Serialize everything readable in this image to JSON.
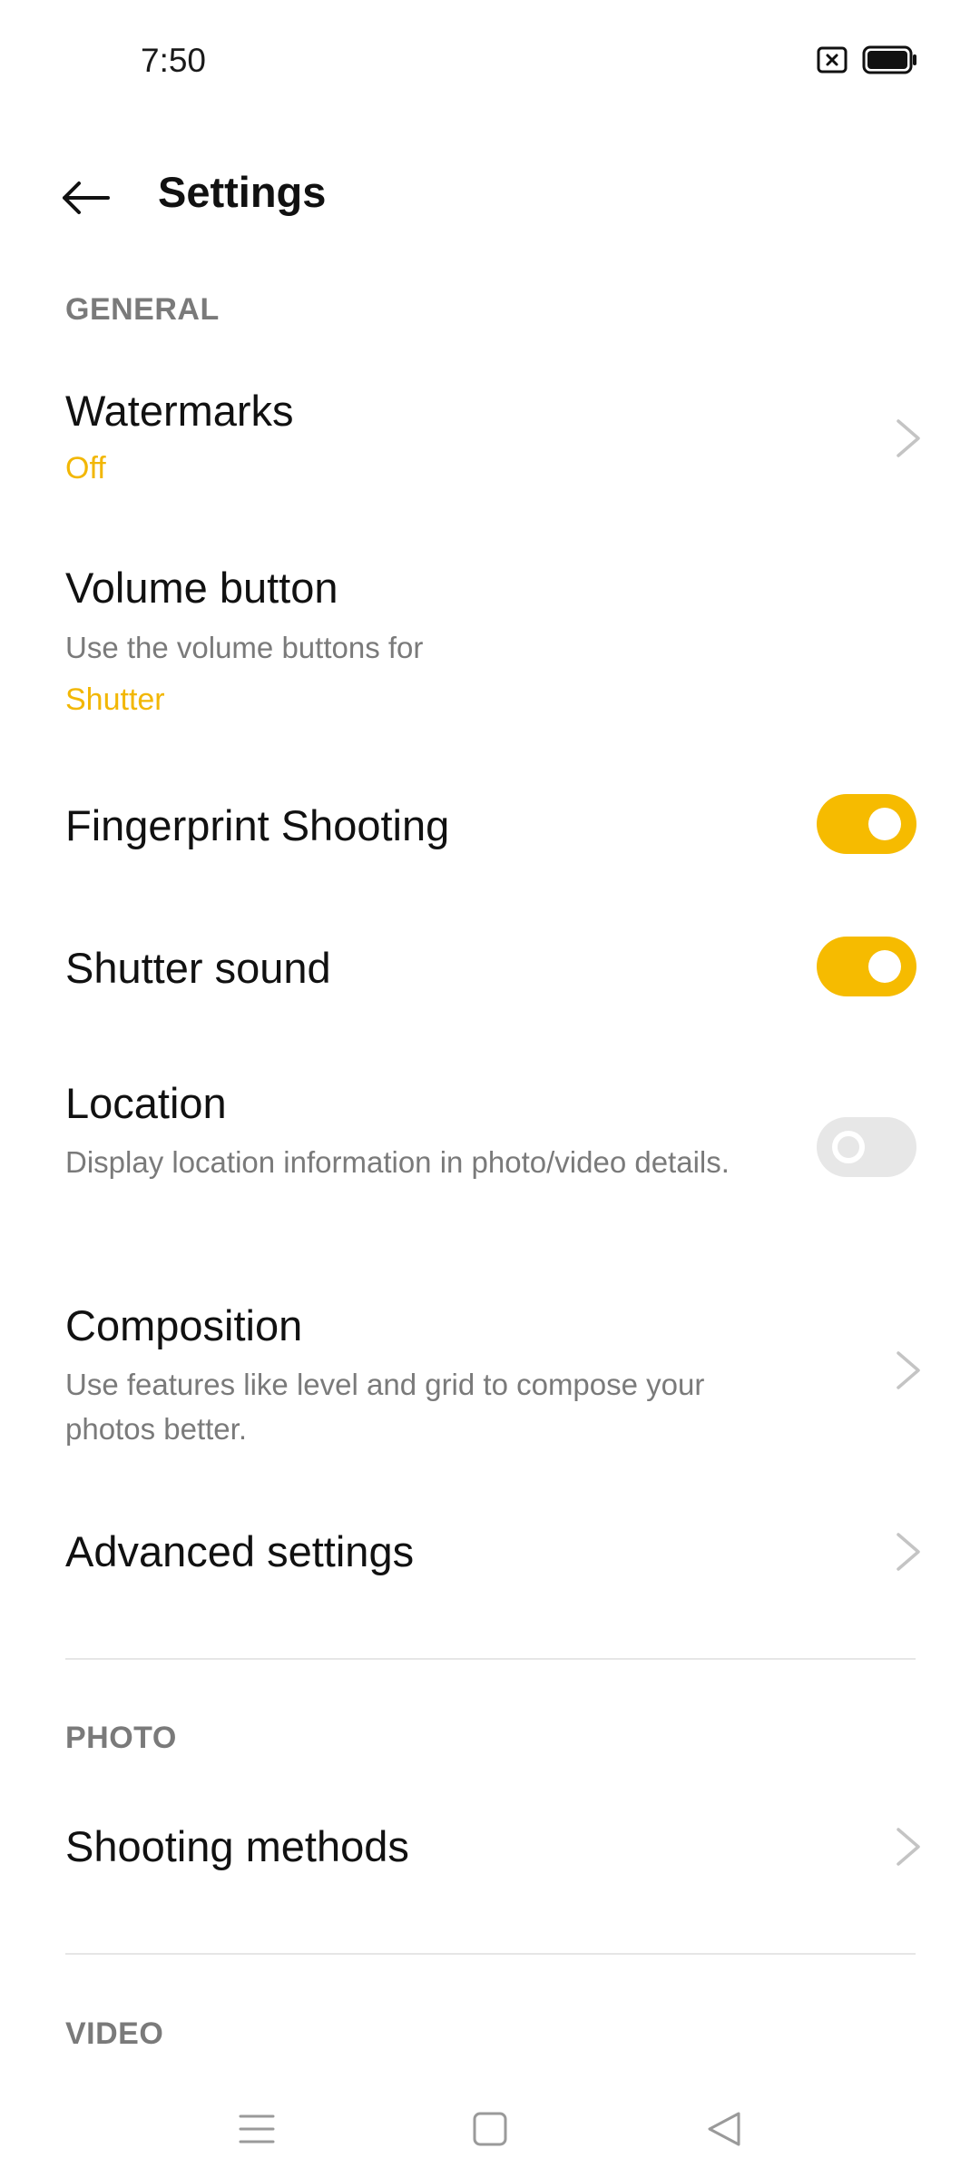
{
  "status_bar": {
    "time": "7:50",
    "icons": [
      "sim-card-x-icon",
      "battery-full-icon"
    ]
  },
  "header": {
    "title": "Settings",
    "back_icon": "arrow-left-icon"
  },
  "sections": {
    "general": {
      "label": "GENERAL",
      "watermarks": {
        "title": "Watermarks",
        "value": "Off"
      },
      "volume_button": {
        "title": "Volume button",
        "subtitle": "Use the volume buttons for",
        "value": "Shutter"
      },
      "fingerprint": {
        "title": "Fingerprint Shooting",
        "enabled": true
      },
      "shutter_sound": {
        "title": "Shutter sound",
        "enabled": true
      },
      "location": {
        "title": "Location",
        "subtitle": "Display location information in photo/video details.",
        "enabled": false
      },
      "composition": {
        "title": "Composition",
        "subtitle": "Use features like level and grid to compose your photos better."
      },
      "advanced": {
        "title": "Advanced settings"
      }
    },
    "photo": {
      "label": "PHOTO",
      "shooting_methods": {
        "title": "Shooting methods"
      }
    },
    "video": {
      "label": "VIDEO"
    }
  },
  "nav_bar": {
    "icons": [
      "menu-icon",
      "home-square-icon",
      "back-triangle-icon"
    ]
  },
  "colors": {
    "accent": "#f6bb00",
    "accent_text": "#f2b705",
    "secondary_text": "#7a7a7a",
    "toggle_off": "#e7e7e7"
  }
}
